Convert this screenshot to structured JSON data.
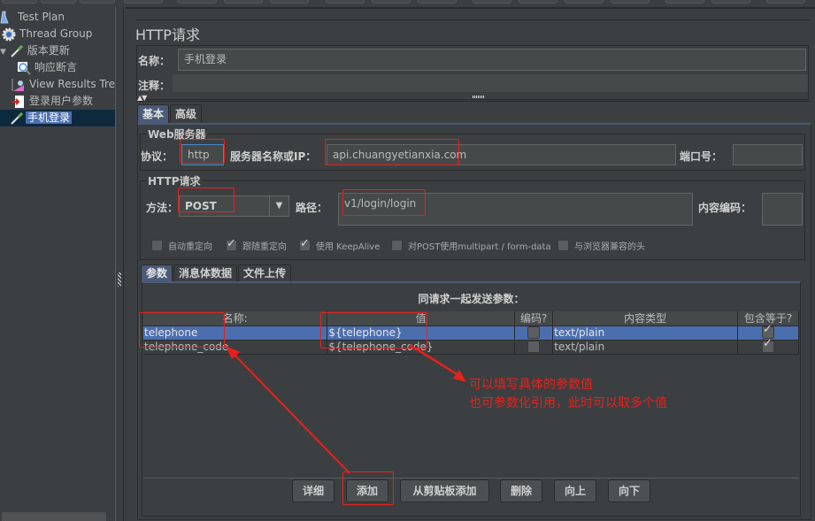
{
  "toolbar": {
    "buttons": 17
  },
  "tree": {
    "items": [
      {
        "label": "Test Plan",
        "icon": "test-plan-icon"
      },
      {
        "label": "Thread Group",
        "icon": "gear-icon"
      },
      {
        "label": "版本更新",
        "icon": "dropper-icon"
      },
      {
        "label": "响应断言",
        "icon": "magnifier-icon"
      },
      {
        "label": "View Results Tree",
        "icon": "chart-icon"
      },
      {
        "label": "登录用户参数",
        "icon": "preprocessor-icon"
      },
      {
        "label": "手机登录",
        "icon": "dropper-icon",
        "selected": true
      }
    ]
  },
  "main": {
    "title": "HTTP请求",
    "name_label": "名称：",
    "name_value": "手机登录",
    "comment_label": "注释：",
    "comment_value": "",
    "tabs": [
      {
        "label": "基本",
        "active": true
      },
      {
        "label": "高级"
      }
    ],
    "web_server": {
      "group_title": "Web服务器",
      "protocol_label": "协议：",
      "protocol_value": "http",
      "server_label": "服务器名称或IP：",
      "server_value": "api.chuangyetianxia.com",
      "port_label": "端口号：",
      "port_value": ""
    },
    "http_request": {
      "group_title": "HTTP请求",
      "method_label": "方法：",
      "method_value": "POST",
      "path_label": "路径：",
      "path_value": "v1/login/login",
      "encoding_label": "内容编码：",
      "encoding_value": ""
    },
    "options": [
      {
        "label": "自动重定向",
        "checked": false
      },
      {
        "label": "跟随重定向",
        "checked": true
      },
      {
        "label": "使用 KeepAlive",
        "checked": true
      },
      {
        "label": "对POST使用multipart / form-data",
        "checked": false
      },
      {
        "label": "与浏览器兼容的头",
        "checked": false
      }
    ],
    "inner_tabs": [
      {
        "label": "参数",
        "active": true
      },
      {
        "label": "消息体数据"
      },
      {
        "label": "文件上传"
      }
    ],
    "params": {
      "title": "同请求一起发送参数：",
      "columns": [
        "名称:",
        "值",
        "编码?",
        "内容类型",
        "包含等于?"
      ],
      "rows": [
        {
          "name": "telephone",
          "value": "${telephone}",
          "encode": false,
          "content_type": "text/plain",
          "include_equals": true,
          "selected": true
        },
        {
          "name": "telephone_code",
          "value": "${telephone_code}",
          "encode": false,
          "content_type": "text/plain",
          "include_equals": true,
          "selected": false
        }
      ]
    },
    "buttons": [
      "详细",
      "添加",
      "从剪贴板添加",
      "删除",
      "向上",
      "向下"
    ]
  },
  "annotations": {
    "line1": "可以填写具体的参数值",
    "line2": "也可参数化引用，此时可以取多个值",
    "color": "#e8201b"
  }
}
